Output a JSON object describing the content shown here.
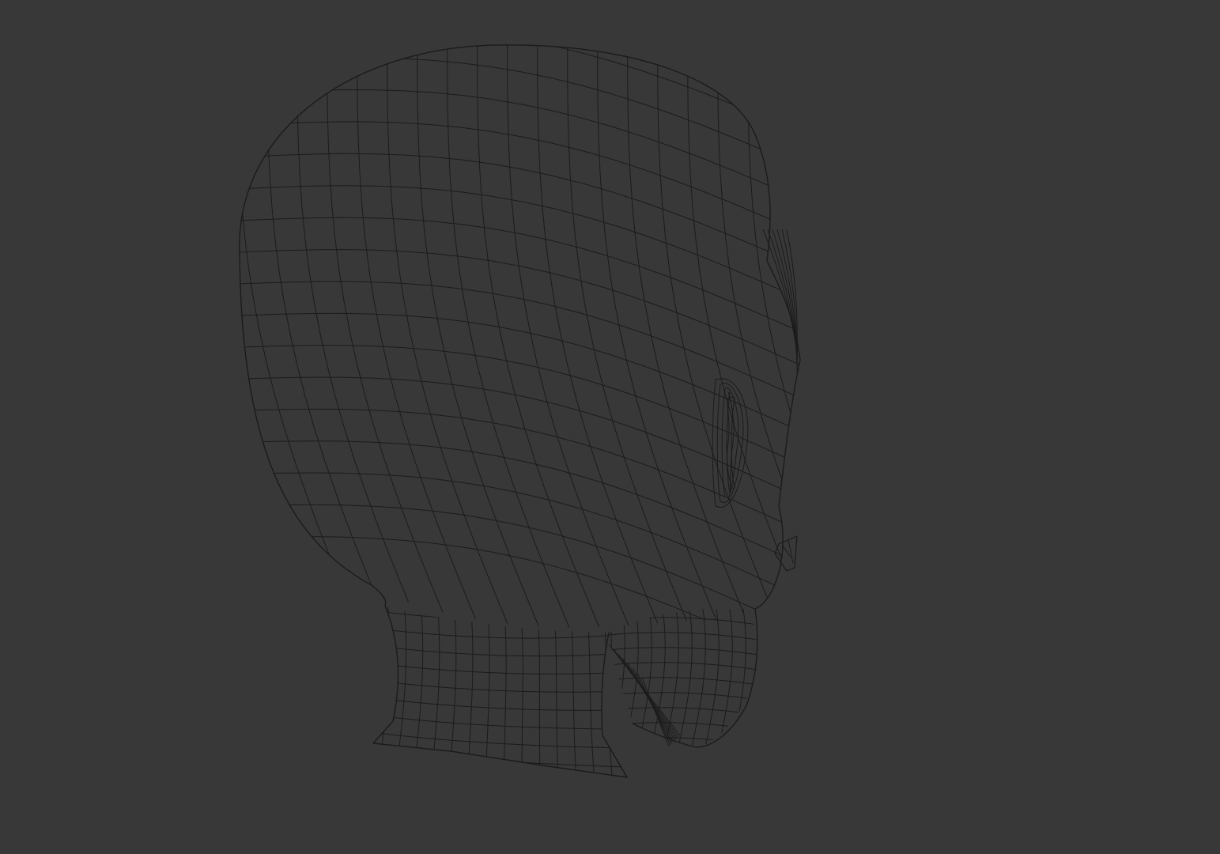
{
  "viewport": {
    "background": "#383838",
    "wire_color": "#1b1b1b",
    "render_mode": "wireframe",
    "subject": "head-mesh"
  }
}
